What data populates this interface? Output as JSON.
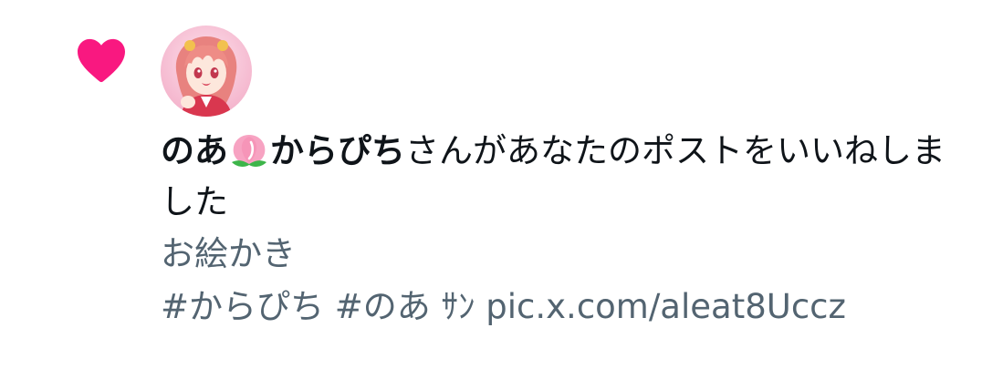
{
  "notification": {
    "type_icon": "heart-icon",
    "accent_color": "#f91880",
    "actor": {
      "name_part1": "のあ",
      "name_emoji": "peach-icon",
      "name_part2": "からぴち",
      "avatar": "avatar"
    },
    "action_text": "さんがあなたのポストをいいねしました",
    "post": {
      "line1": "お絵かき",
      "line2": "#からぴち #のあ ｻﾝ pic.x.com/aleat8Uccz"
    },
    "colors": {
      "primary_text": "#0f1419",
      "secondary_text": "#536471",
      "background": "#ffffff"
    }
  }
}
